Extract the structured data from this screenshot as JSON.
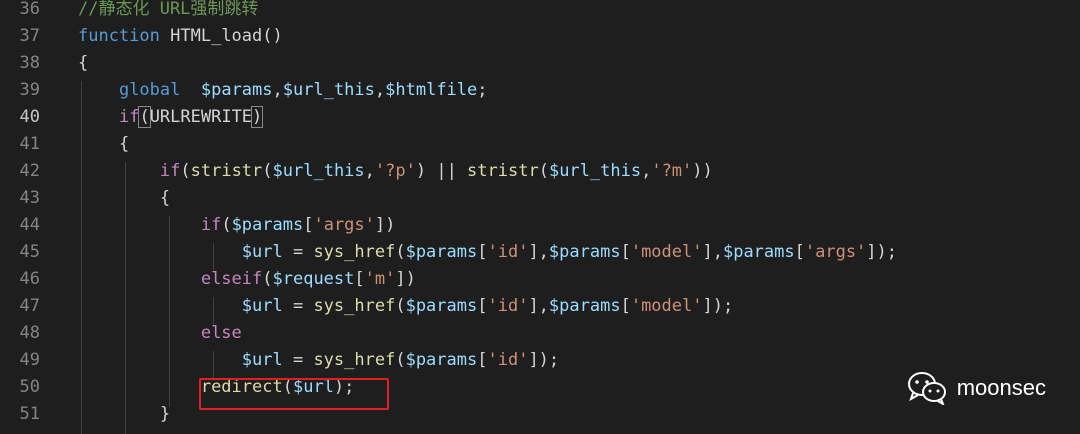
{
  "editor": {
    "lines": [
      {
        "n": "36",
        "tokens": [
          {
            "t": "//静态化 URL强制跳转",
            "c": "t-comment"
          }
        ]
      },
      {
        "n": "37",
        "tokens": [
          {
            "t": "function",
            "c": "t-keyword"
          },
          {
            "t": " ",
            "c": "t-plain"
          },
          {
            "t": "HTML_load",
            "c": "t-plain"
          },
          {
            "t": "()",
            "c": "t-plain"
          }
        ]
      },
      {
        "n": "38",
        "tokens": [
          {
            "t": "{",
            "c": "t-plain"
          }
        ]
      },
      {
        "n": "39",
        "tokens": [
          {
            "t": "    ",
            "c": "t-plain"
          },
          {
            "t": "global",
            "c": "t-keyword"
          },
          {
            "t": "  ",
            "c": "t-plain"
          },
          {
            "t": "$params",
            "c": "t-var"
          },
          {
            "t": ",",
            "c": "t-plain"
          },
          {
            "t": "$url_this",
            "c": "t-var"
          },
          {
            "t": ",",
            "c": "t-plain"
          },
          {
            "t": "$htmlfile",
            "c": "t-var"
          },
          {
            "t": ";",
            "c": "t-plain"
          }
        ]
      },
      {
        "n": "40",
        "active": true,
        "tokens": [
          {
            "t": "    ",
            "c": "t-plain"
          },
          {
            "t": "if",
            "c": "t-ctrl"
          },
          {
            "t": "(",
            "c": "t-bracket bracket-match"
          },
          {
            "t": "URLREWRITE",
            "c": "t-const"
          },
          {
            "t": ")",
            "c": "t-bracket bracket-match"
          }
        ]
      },
      {
        "n": "41",
        "tokens": [
          {
            "t": "    ",
            "c": "t-plain"
          },
          {
            "t": "{",
            "c": "t-plain"
          }
        ]
      },
      {
        "n": "42",
        "tokens": [
          {
            "t": "        ",
            "c": "t-plain"
          },
          {
            "t": "if",
            "c": "t-ctrl"
          },
          {
            "t": "(",
            "c": "t-plain"
          },
          {
            "t": "stristr",
            "c": "t-func"
          },
          {
            "t": "(",
            "c": "t-plain"
          },
          {
            "t": "$url_this",
            "c": "t-var"
          },
          {
            "t": ",",
            "c": "t-plain"
          },
          {
            "t": "'?p'",
            "c": "t-str"
          },
          {
            "t": ") || ",
            "c": "t-plain"
          },
          {
            "t": "stristr",
            "c": "t-func"
          },
          {
            "t": "(",
            "c": "t-plain"
          },
          {
            "t": "$url_this",
            "c": "t-var"
          },
          {
            "t": ",",
            "c": "t-plain"
          },
          {
            "t": "'?m'",
            "c": "t-str"
          },
          {
            "t": "))",
            "c": "t-plain"
          }
        ]
      },
      {
        "n": "43",
        "tokens": [
          {
            "t": "        ",
            "c": "t-plain"
          },
          {
            "t": "{",
            "c": "t-plain"
          }
        ]
      },
      {
        "n": "44",
        "tokens": [
          {
            "t": "            ",
            "c": "t-plain"
          },
          {
            "t": "if",
            "c": "t-ctrl"
          },
          {
            "t": "(",
            "c": "t-plain"
          },
          {
            "t": "$params",
            "c": "t-var"
          },
          {
            "t": "[",
            "c": "t-plain"
          },
          {
            "t": "'args'",
            "c": "t-str"
          },
          {
            "t": "])",
            "c": "t-plain"
          }
        ]
      },
      {
        "n": "45",
        "tokens": [
          {
            "t": "                ",
            "c": "t-plain"
          },
          {
            "t": "$url",
            "c": "t-var"
          },
          {
            "t": " = ",
            "c": "t-plain"
          },
          {
            "t": "sys_href",
            "c": "t-func"
          },
          {
            "t": "(",
            "c": "t-plain"
          },
          {
            "t": "$params",
            "c": "t-var"
          },
          {
            "t": "[",
            "c": "t-plain"
          },
          {
            "t": "'id'",
            "c": "t-str"
          },
          {
            "t": "],",
            "c": "t-plain"
          },
          {
            "t": "$params",
            "c": "t-var"
          },
          {
            "t": "[",
            "c": "t-plain"
          },
          {
            "t": "'model'",
            "c": "t-str"
          },
          {
            "t": "],",
            "c": "t-plain"
          },
          {
            "t": "$params",
            "c": "t-var"
          },
          {
            "t": "[",
            "c": "t-plain"
          },
          {
            "t": "'args'",
            "c": "t-str"
          },
          {
            "t": "]);",
            "c": "t-plain"
          }
        ]
      },
      {
        "n": "46",
        "tokens": [
          {
            "t": "            ",
            "c": "t-plain"
          },
          {
            "t": "elseif",
            "c": "t-ctrl"
          },
          {
            "t": "(",
            "c": "t-plain"
          },
          {
            "t": "$request",
            "c": "t-var"
          },
          {
            "t": "[",
            "c": "t-plain"
          },
          {
            "t": "'m'",
            "c": "t-str"
          },
          {
            "t": "])",
            "c": "t-plain"
          }
        ]
      },
      {
        "n": "47",
        "tokens": [
          {
            "t": "                ",
            "c": "t-plain"
          },
          {
            "t": "$url",
            "c": "t-var"
          },
          {
            "t": " = ",
            "c": "t-plain"
          },
          {
            "t": "sys_href",
            "c": "t-func"
          },
          {
            "t": "(",
            "c": "t-plain"
          },
          {
            "t": "$params",
            "c": "t-var"
          },
          {
            "t": "[",
            "c": "t-plain"
          },
          {
            "t": "'id'",
            "c": "t-str"
          },
          {
            "t": "],",
            "c": "t-plain"
          },
          {
            "t": "$params",
            "c": "t-var"
          },
          {
            "t": "[",
            "c": "t-plain"
          },
          {
            "t": "'model'",
            "c": "t-str"
          },
          {
            "t": "]);",
            "c": "t-plain"
          }
        ]
      },
      {
        "n": "48",
        "tokens": [
          {
            "t": "            ",
            "c": "t-plain"
          },
          {
            "t": "else",
            "c": "t-ctrl"
          }
        ]
      },
      {
        "n": "49",
        "tokens": [
          {
            "t": "                ",
            "c": "t-plain"
          },
          {
            "t": "$url",
            "c": "t-var"
          },
          {
            "t": " = ",
            "c": "t-plain"
          },
          {
            "t": "sys_href",
            "c": "t-func"
          },
          {
            "t": "(",
            "c": "t-plain"
          },
          {
            "t": "$params",
            "c": "t-var"
          },
          {
            "t": "[",
            "c": "t-plain"
          },
          {
            "t": "'id'",
            "c": "t-str"
          },
          {
            "t": "]);",
            "c": "t-plain"
          }
        ]
      },
      {
        "n": "50",
        "tokens": [
          {
            "t": "            ",
            "c": "t-plain"
          },
          {
            "t": "redirect",
            "c": "t-func"
          },
          {
            "t": "(",
            "c": "t-plain"
          },
          {
            "t": "$url",
            "c": "t-var"
          },
          {
            "t": ");",
            "c": "t-plain"
          }
        ]
      },
      {
        "n": "51",
        "tokens": [
          {
            "t": "        ",
            "c": "t-plain"
          },
          {
            "t": "}",
            "c": "t-plain"
          }
        ]
      }
    ]
  },
  "watermark": {
    "text": "moonsec",
    "icon": "wechat-icon"
  },
  "colors": {
    "background": "#1e1e1e",
    "comment": "#6a9955",
    "keyword": "#569cd6",
    "control": "#c586c0",
    "variable": "#9cdcfe",
    "function": "#dcdcaa",
    "string": "#ce9178",
    "highlight_box": "#e02020"
  }
}
